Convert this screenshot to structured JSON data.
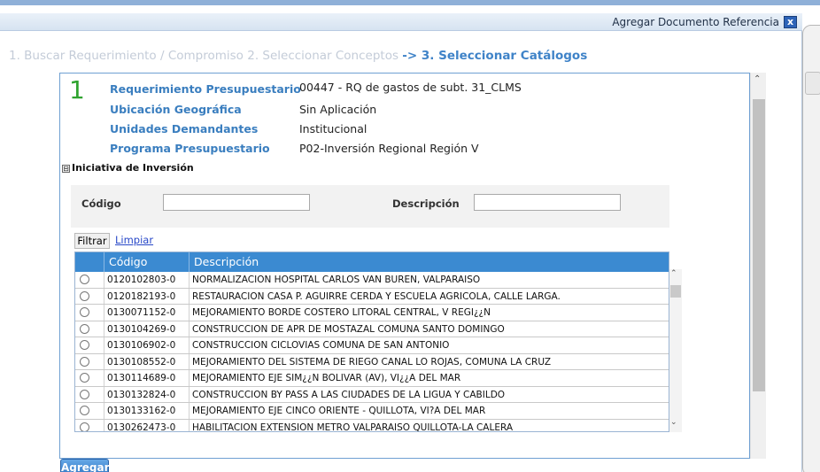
{
  "dialog": {
    "title": "Agregar Documento Referencia",
    "close_label": "x"
  },
  "steps": {
    "step1": "1. Buscar Requerimiento / Compromiso",
    "step2": "2. Seleccionar Conceptos",
    "step3": "-> 3. Seleccionar Catálogos"
  },
  "summary": {
    "number": "1",
    "rows": [
      {
        "label": "Requerimiento Presupuestario",
        "value": "00447 - RQ de gastos de subt. 31_CLMS"
      },
      {
        "label": "Ubicación Geográfica",
        "value": "Sin Aplicación"
      },
      {
        "label": "Unidades Demandantes",
        "value": "Institucional"
      },
      {
        "label": "Programa Presupuestario",
        "value": "P02-Inversión Regional Región V"
      }
    ]
  },
  "section": {
    "toggle": "⊟",
    "title": "Iniciativa de Inversión"
  },
  "filter": {
    "codigo_label": "Código",
    "codigo_value": "",
    "descripcion_label": "Descripción",
    "descripcion_value": "",
    "filtrar_label": "Filtrar",
    "limpiar_label": "Limpiar"
  },
  "grid": {
    "columns": [
      "Código",
      "Descripción"
    ],
    "rows": [
      {
        "code": "0120102803-0",
        "desc": "NORMALIZACION HOSPITAL CARLOS VAN BUREN, VALPARAISO"
      },
      {
        "code": "0120182193-0",
        "desc": "RESTAURACION CASA P. AGUIRRE CERDA Y ESCUELA AGRICOLA, CALLE LARGA."
      },
      {
        "code": "0130071152-0",
        "desc": "MEJORAMIENTO BORDE COSTERO LITORAL CENTRAL, V REGI¿¿N"
      },
      {
        "code": "0130104269-0",
        "desc": "CONSTRUCCION DE APR DE MOSTAZAL COMUNA SANTO DOMINGO"
      },
      {
        "code": "0130106902-0",
        "desc": "CONSTRUCCION CICLOVIAS COMUNA DE SAN ANTONIO"
      },
      {
        "code": "0130108552-0",
        "desc": "MEJORAMIENTO DEL SISTEMA DE RIEGO CANAL LO ROJAS, COMUNA LA CRUZ"
      },
      {
        "code": "0130114689-0",
        "desc": "MEJORAMIENTO EJE SIM¿¿N BOLIVAR (AV), VI¿¿A DEL MAR"
      },
      {
        "code": "0130132824-0",
        "desc": "CONSTRUCCION BY PASS A LAS CIUDADES DE LA LIGUA Y CABILDO"
      },
      {
        "code": "0130133162-0",
        "desc": "MEJORAMIENTO EJE CINCO ORIENTE - QUILLOTA, VI?A DEL MAR"
      },
      {
        "code": "0130262473-0",
        "desc": "HABILITACION EXTENSION METRO VALPARAISO QUILLOTA-LA CALERA"
      }
    ]
  },
  "actions": {
    "agregar_label": "Agregar"
  }
}
